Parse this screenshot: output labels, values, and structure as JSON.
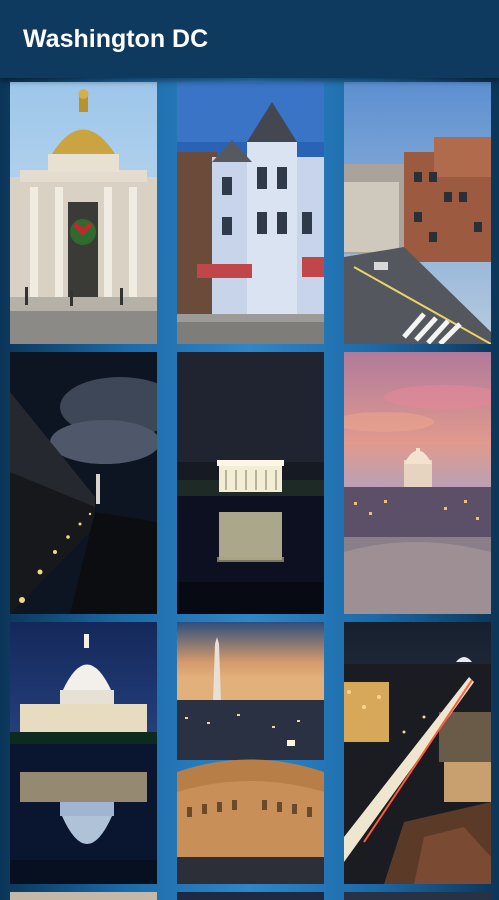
{
  "app": {
    "title": "Washington DC"
  },
  "grid": {
    "tiles": [
      {
        "icon": "domed-bank-building-photo"
      },
      {
        "icon": "victorian-corner-house-photo"
      },
      {
        "icon": "city-street-aerial-photo"
      },
      {
        "icon": "vietnam-memorial-wall-night-photo"
      },
      {
        "icon": "lincoln-memorial-night-photo"
      },
      {
        "icon": "capitol-sunset-skyline-photo"
      },
      {
        "icon": "capitol-reflection-night-photo"
      },
      {
        "icon": "washington-monument-aerial-photo"
      },
      {
        "icon": "pennsylvania-avenue-night-photo"
      }
    ]
  },
  "colors": {
    "appbar": "#0d3a5e",
    "background_edge": "#0b3558",
    "background_center": "#2f86c8"
  }
}
